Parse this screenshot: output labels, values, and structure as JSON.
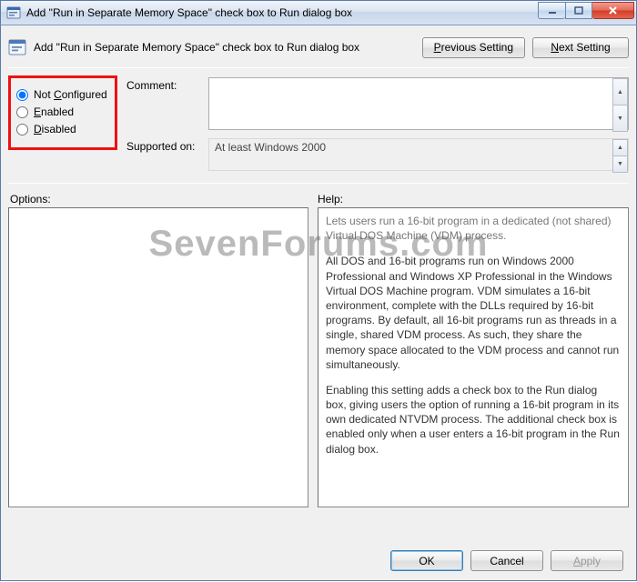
{
  "window": {
    "title": "Add \"Run in Separate Memory Space\" check box to Run dialog box"
  },
  "header": {
    "policy_title": "Add \"Run in Separate Memory Space\" check box to Run dialog box",
    "previous_setting": "Previous Setting",
    "next_setting": "Next Setting",
    "prev_underline": "P",
    "next_underline": "N"
  },
  "state": {
    "options": [
      {
        "value": "not_configured",
        "label": "Not Configured",
        "underline": "C"
      },
      {
        "value": "enabled",
        "label": "Enabled",
        "underline": "E"
      },
      {
        "value": "disabled",
        "label": "Disabled",
        "underline": "D"
      }
    ],
    "selected": "not_configured"
  },
  "fields": {
    "comment_label": "Comment:",
    "comment_value": "",
    "supported_label": "Supported on:",
    "supported_value": "At least Windows 2000"
  },
  "lower": {
    "options_label": "Options:",
    "help_label": "Help:"
  },
  "help": {
    "p1": "Lets users run a 16-bit program in a dedicated (not shared) Virtual DOS Machine (VDM) process.",
    "p2": "All DOS and 16-bit programs run on Windows 2000 Professional and Windows XP Professional in the Windows Virtual DOS Machine program. VDM simulates a 16-bit environment, complete with the DLLs required by 16-bit programs. By default, all 16-bit programs run as threads in a single, shared VDM process. As such, they share the memory space allocated to the VDM process and cannot run simultaneously.",
    "p3": "Enabling this setting adds a check box to the Run dialog box, giving users the option of running a 16-bit program in its own dedicated NTVDM process. The additional check box is enabled only when a user enters a 16-bit program in the Run dialog box."
  },
  "footer": {
    "ok": "OK",
    "cancel": "Cancel",
    "apply": "Apply",
    "apply_underline": "A"
  },
  "watermark": "SevenForums.com"
}
